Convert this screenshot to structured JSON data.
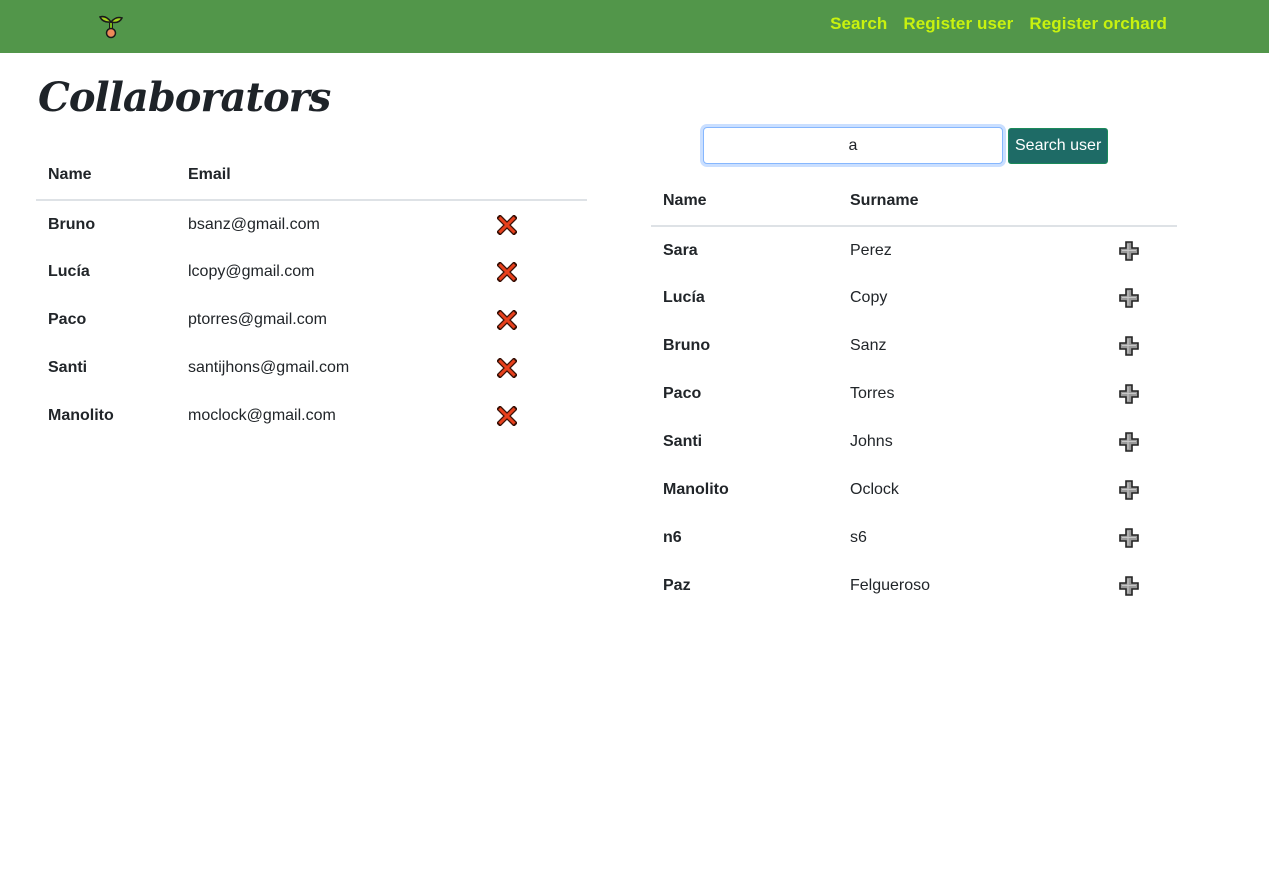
{
  "navbar": {
    "logo_icon": "seedling-icon",
    "links": [
      {
        "label": "Search"
      },
      {
        "label": "Register user"
      },
      {
        "label": "Register orchard"
      }
    ],
    "background_color": "#52964a",
    "link_color": "#c8f20f"
  },
  "page": {
    "title": "Collaborators"
  },
  "collaborators": {
    "headers": {
      "name": "Name",
      "email": "Email"
    },
    "remove_icon": "red-x-icon",
    "rows": [
      {
        "name": "Bruno",
        "email": "bsanz@gmail.com"
      },
      {
        "name": "Lucía",
        "email": "lcopy@gmail.com"
      },
      {
        "name": "Paco",
        "email": "ptorres@gmail.com"
      },
      {
        "name": "Santi",
        "email": "santijhons@gmail.com"
      },
      {
        "name": "Manolito",
        "email": "moclock@gmail.com"
      }
    ]
  },
  "user_search": {
    "input_value": "a",
    "button_label": "Search user",
    "button_color": "#1e6b66",
    "headers": {
      "name": "Name",
      "surname": "Surname"
    },
    "add_icon": "plus-icon",
    "rows": [
      {
        "name": "Sara",
        "surname": "Perez"
      },
      {
        "name": "Lucía",
        "surname": "Copy"
      },
      {
        "name": "Bruno",
        "surname": "Sanz"
      },
      {
        "name": "Paco",
        "surname": "Torres"
      },
      {
        "name": "Santi",
        "surname": "Johns"
      },
      {
        "name": "Manolito",
        "surname": "Oclock"
      },
      {
        "name": "n6",
        "surname": "s6"
      },
      {
        "name": "Paz",
        "surname": "Felgueroso"
      }
    ]
  }
}
